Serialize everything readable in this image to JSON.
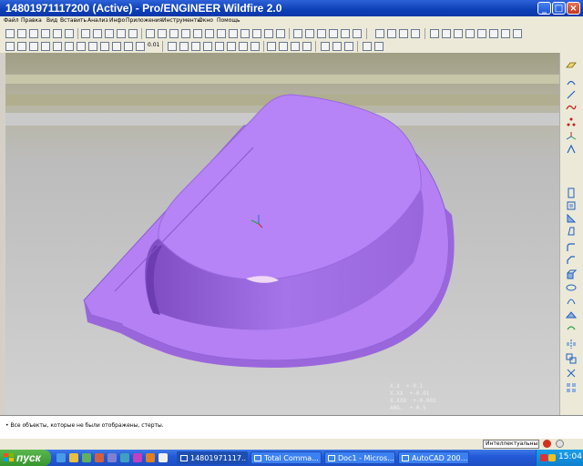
{
  "window": {
    "title": "14801971117200 (Active) - Pro/ENGINEER Wildfire 2.0",
    "minimize_icon": "minimize-icon",
    "maximize_icon": "maximize-icon",
    "close_icon": "close-icon"
  },
  "menu": [
    "Файл",
    "Правка",
    "Вид",
    "Вставить",
    "Анализ",
    "Инфо",
    "Приложения",
    "Инструменты",
    "Окно",
    "Помощь"
  ],
  "toolbar": {
    "precision_value": "0.01"
  },
  "viewport": {
    "tolerances": [
      "X.X  +-0.1",
      "X.XX  +-0.01",
      "X.XXX  +-0.001",
      "ANG.  +-0.5"
    ]
  },
  "message": {
    "text": "• Все объекты, которые не были отображены, стерты."
  },
  "status": {
    "filter_value": "Интеллектуальный"
  },
  "taskbar": {
    "start_label": "пуск",
    "tasks": [
      "14801971117...",
      "Total Comma...",
      "Doc1 - Micros...",
      "AutoCAD 200..."
    ],
    "clock": "15:04"
  },
  "colors": {
    "part_top": "#b480f4",
    "part_side": "#9a66dc",
    "part_shadow": "#7e4cc0",
    "titlebar": "#0d3fb7",
    "taskbar": "#245ad8"
  }
}
